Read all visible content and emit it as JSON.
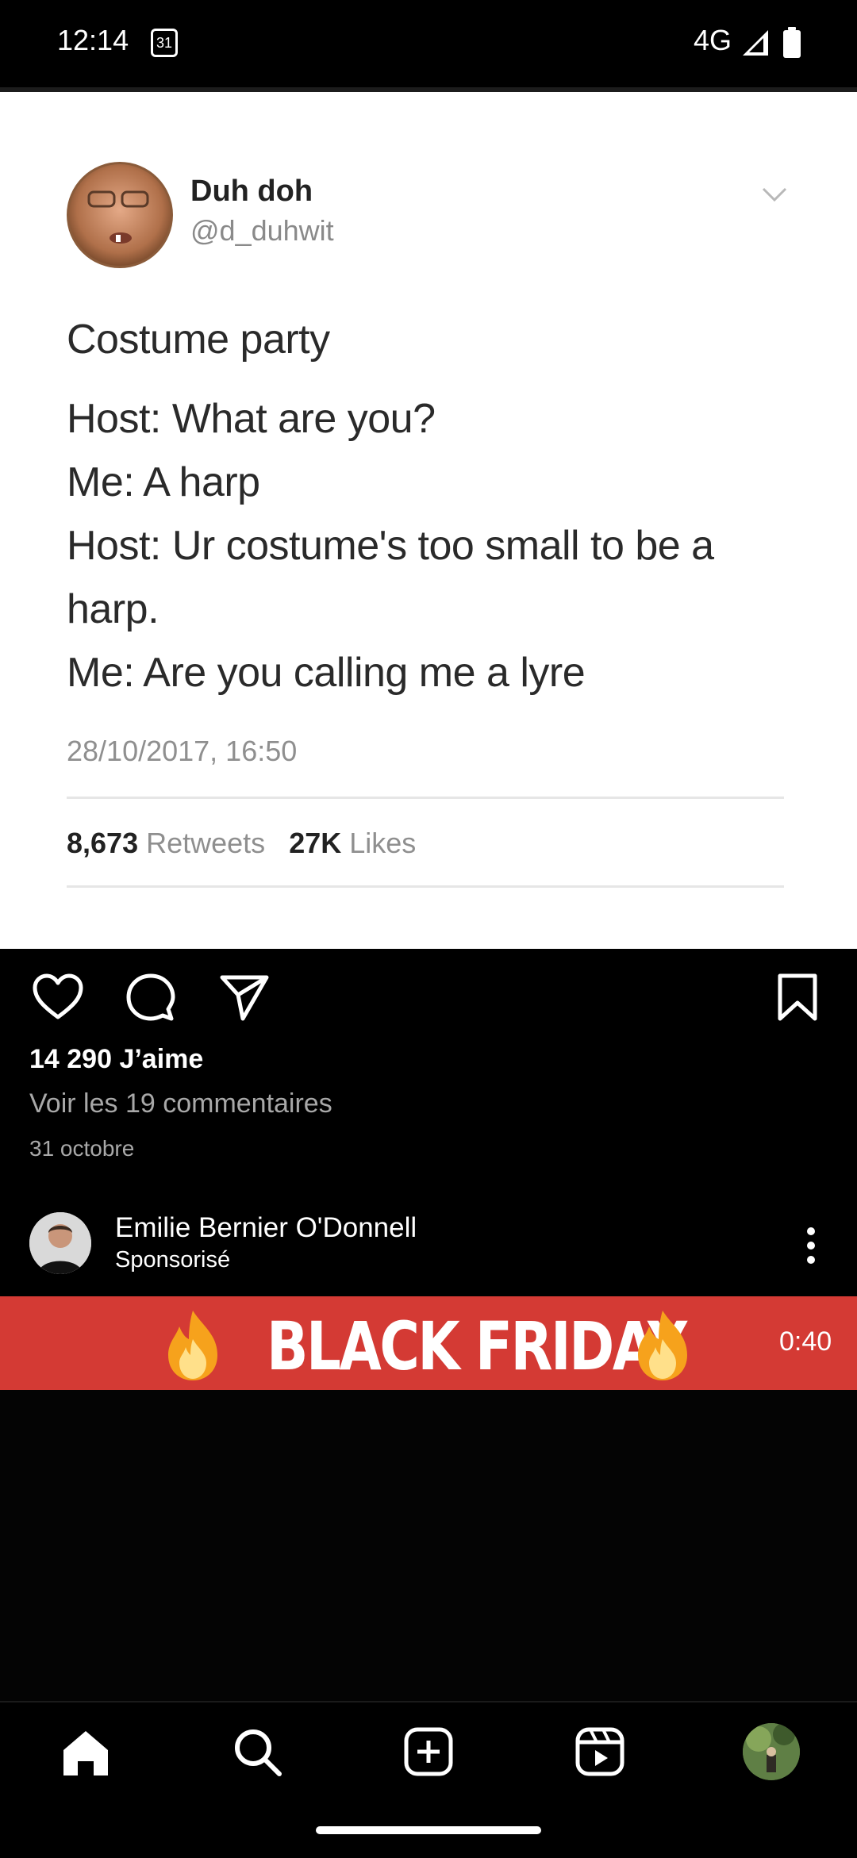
{
  "status_bar": {
    "time": "12:14",
    "calendar_day": "31",
    "network": "4G"
  },
  "tweet": {
    "name": "Duh doh",
    "handle": "@d_duhwit",
    "lines": [
      "Costume party",
      "Host: What are you?",
      "Me: A harp",
      "Host: Ur costume's too small to be a",
      "harp.",
      "Me: Are you calling me a lyre"
    ],
    "date": "28/10/2017, 16:50",
    "retweets_count": "8,673",
    "retweets_label": "Retweets",
    "likes_count": "27K",
    "likes_label": "Likes"
  },
  "post": {
    "likes": "14 290 J’aime",
    "comments_link": "Voir les 19 commentaires",
    "date": "31 octobre"
  },
  "sponsored": {
    "name": "Emilie Bernier O'Donnell",
    "label": "Sponsorisé",
    "banner_text": "BLACK FRIDAY",
    "video_time": "0:40"
  },
  "icons": [
    "heart-icon",
    "comment-icon",
    "share-icon",
    "bookmark-icon",
    "home-icon",
    "search-icon",
    "create-icon",
    "reels-icon"
  ],
  "colors": {
    "banner": "#d43a34",
    "background": "#000000"
  }
}
